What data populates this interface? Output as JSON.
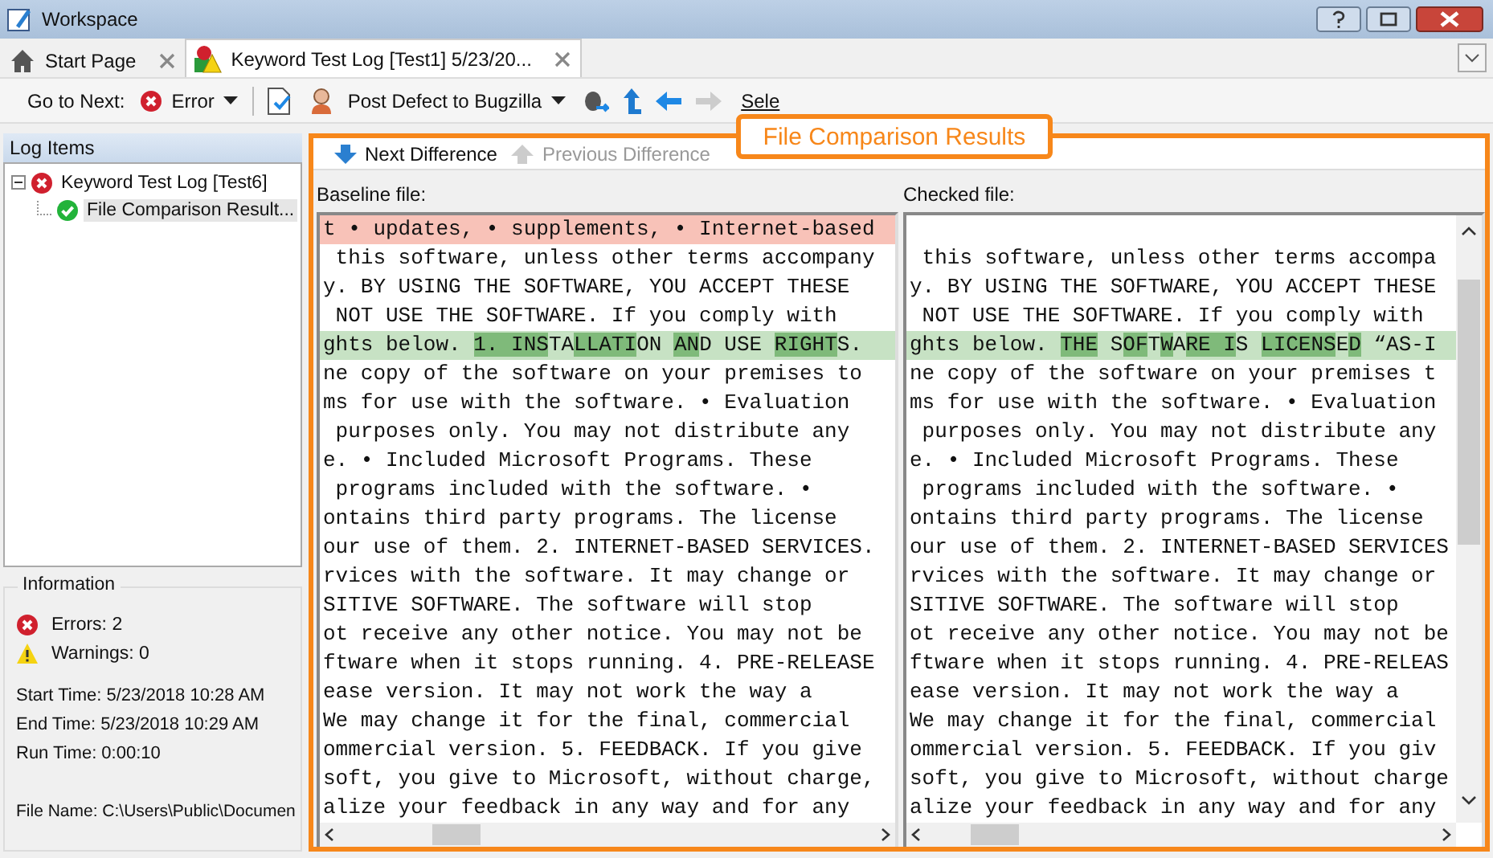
{
  "window": {
    "title": "Workspace"
  },
  "tabs": [
    {
      "label": "Start Page",
      "selected": false
    },
    {
      "label": "Keyword Test Log  [Test1] 5/23/20...",
      "selected": true
    }
  ],
  "toolbar": {
    "goto_label": "Go to Next:",
    "goto_value": "Error",
    "post_defect": "Post Defect to Bugzilla",
    "select_panel": "Sele"
  },
  "callout": "File Comparison Results",
  "log_items": {
    "title": "Log Items",
    "tree": [
      {
        "label": "Keyword Test Log [Test6]",
        "passed": false,
        "expanded": true,
        "selected": false,
        "children": [
          {
            "label": "File Comparison Result...",
            "passed": true,
            "selected": true
          }
        ]
      }
    ]
  },
  "information": {
    "title": "Information",
    "errors": "Errors: 2",
    "warnings": "Warnings: 0",
    "start_time": "Start Time: 5/23/2018 10:28 AM",
    "end_time": "End Time: 5/23/2018 10:29 AM",
    "run_time": "Run Time: 0:00:10",
    "file_name": "File Name: C:\\Users\\Public\\Documen"
  },
  "comparison": {
    "next": {
      "label": "Next Difference",
      "disabled": false
    },
    "previous": {
      "label": "Previous Difference",
      "disabled": true
    },
    "panes": [
      {
        "label": "Baseline file:",
        "lines": [
          {
            "kind": "removed",
            "text": "t • updates, • supplements, • Internet-based"
          },
          {
            "kind": "plain",
            "text": " this software, unless other terms accompany"
          },
          {
            "kind": "plain",
            "text": "y. BY USING THE SOFTWARE, YOU ACCEPT THESE"
          },
          {
            "kind": "plain",
            "text": " NOT USE THE SOFTWARE. If you comply with"
          },
          {
            "kind": "modified",
            "segments": [
              {
                "text": "ghts below. ",
                "changed": false
              },
              {
                "text": "1. ",
                "changed": true
              },
              {
                "text": "INS",
                "changed": true
              },
              {
                "text": "TA",
                "changed": false
              },
              {
                "text": "LLATI",
                "changed": true
              },
              {
                "text": "ON ",
                "changed": false
              },
              {
                "text": "AN",
                "changed": true
              },
              {
                "text": "D USE ",
                "changed": false
              },
              {
                "text": "RIGHT",
                "changed": true
              },
              {
                "text": "S.",
                "changed": false
              }
            ]
          },
          {
            "kind": "plain",
            "text": "ne copy of the software on your premises to"
          },
          {
            "kind": "plain",
            "text": "ms for use with the software. • Evaluation"
          },
          {
            "kind": "plain",
            "text": " purposes only. You may not distribute any"
          },
          {
            "kind": "plain",
            "text": "e. • Included Microsoft Programs. These"
          },
          {
            "kind": "plain",
            "text": " programs included with the software. •"
          },
          {
            "kind": "plain",
            "text": "ontains third party programs. The license"
          },
          {
            "kind": "plain",
            "text": "our use of them. 2. INTERNET-BASED SERVICES."
          },
          {
            "kind": "plain",
            "text": "rvices with the software. It may change or"
          },
          {
            "kind": "plain",
            "text": "SITIVE SOFTWARE. The software will stop"
          },
          {
            "kind": "plain",
            "text": "ot receive any other notice. You may not be"
          },
          {
            "kind": "plain",
            "text": "ftware when it stops running. 4. PRE-RELEASE"
          },
          {
            "kind": "plain",
            "text": "ease version. It may not work the way a"
          },
          {
            "kind": "plain",
            "text": "We may change it for the final, commercial"
          },
          {
            "kind": "plain",
            "text": "ommercial version. 5. FEEDBACK. If you give"
          },
          {
            "kind": "plain",
            "text": "soft, you give to Microsoft, without charge,"
          },
          {
            "kind": "plain",
            "text": "alize your feedback in any way and for any"
          }
        ]
      },
      {
        "label": "Checked file:",
        "lines": [
          {
            "kind": "blank"
          },
          {
            "kind": "plain",
            "text": " this software, unless other terms accompa"
          },
          {
            "kind": "plain",
            "text": "y. BY USING THE SOFTWARE, YOU ACCEPT THESE"
          },
          {
            "kind": "plain",
            "text": " NOT USE THE SOFTWARE. If you comply with"
          },
          {
            "kind": "modified",
            "segments": [
              {
                "text": "ghts below. ",
                "changed": false
              },
              {
                "text": "THE",
                "changed": true
              },
              {
                "text": " S",
                "changed": false
              },
              {
                "text": "OF",
                "changed": true
              },
              {
                "text": "T",
                "changed": false
              },
              {
                "text": "W",
                "changed": true
              },
              {
                "text": "A",
                "changed": false
              },
              {
                "text": "RE ",
                "changed": true
              },
              {
                "text": "I",
                "changed": true
              },
              {
                "text": "S ",
                "changed": false
              },
              {
                "text": "LICENS",
                "changed": true
              },
              {
                "text": "E",
                "changed": false
              },
              {
                "text": "D",
                "changed": true
              },
              {
                "text": " “AS-I",
                "changed": false
              }
            ]
          },
          {
            "kind": "plain",
            "text": "ne copy of the software on your premises t"
          },
          {
            "kind": "plain",
            "text": "ms for use with the software. • Evaluation"
          },
          {
            "kind": "plain",
            "text": " purposes only. You may not distribute any"
          },
          {
            "kind": "plain",
            "text": "e. • Included Microsoft Programs. These"
          },
          {
            "kind": "plain",
            "text": " programs included with the software. •"
          },
          {
            "kind": "plain",
            "text": "ontains third party programs. The license"
          },
          {
            "kind": "plain",
            "text": "our use of them. 2. INTERNET-BASED SERVICES"
          },
          {
            "kind": "plain",
            "text": "rvices with the software. It may change or"
          },
          {
            "kind": "plain",
            "text": "SITIVE SOFTWARE. The software will stop"
          },
          {
            "kind": "plain",
            "text": "ot receive any other notice. You may not be"
          },
          {
            "kind": "plain",
            "text": "ftware when it stops running. 4. PRE-RELEAS"
          },
          {
            "kind": "plain",
            "text": "ease version. It may not work the way a"
          },
          {
            "kind": "plain",
            "text": "We may change it for the final, commercial"
          },
          {
            "kind": "plain",
            "text": "ommercial version. 5. FEEDBACK. If you giv"
          },
          {
            "kind": "plain",
            "text": "soft, you give to Microsoft, without charge"
          },
          {
            "kind": "plain",
            "text": "alize your feedback in any way and for any"
          }
        ]
      }
    ]
  }
}
